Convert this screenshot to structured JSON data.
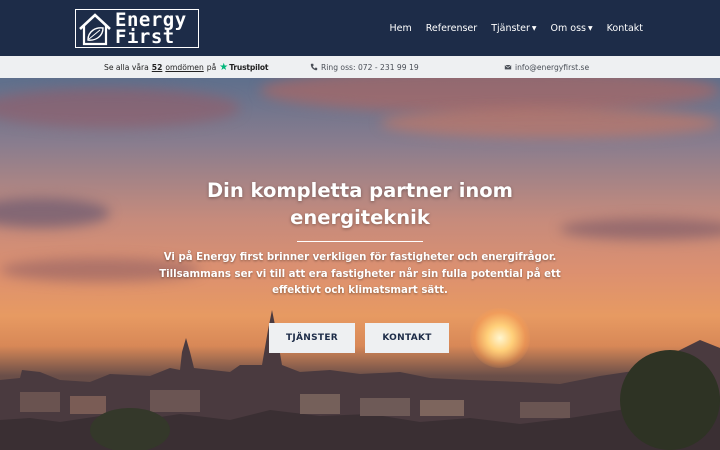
{
  "logo": {
    "line1": "Energy",
    "line2": "First",
    "icon": "house-leaf-icon"
  },
  "nav": {
    "items": [
      {
        "label": "Hem",
        "has_dropdown": false
      },
      {
        "label": "Referenser",
        "has_dropdown": false
      },
      {
        "label": "Tjänster",
        "has_dropdown": true
      },
      {
        "label": "Om oss",
        "has_dropdown": true
      },
      {
        "label": "Kontakt",
        "has_dropdown": false
      }
    ],
    "caret": "⌄"
  },
  "infobar": {
    "trust_prefix": "Se alla våra",
    "trust_count": "52",
    "trust_link": "omdömen",
    "trust_on": "på",
    "trust_brand": "Trustpilot",
    "phone": "Ring oss: 072 - 231 99 19",
    "email": "info@energyfirst.se"
  },
  "hero": {
    "title": "Din kompletta partner inom energiteknik",
    "subtitle": "Vi på Energy first brinner verkligen för fastigheter och energifrågor. Tillsammans ser vi till att era fastigheter når sin fulla potential på ett effektivt och klimatsmart sätt.",
    "button_services": "TJÄNSTER",
    "button_contact": "KONTAKT"
  },
  "colors": {
    "header_bg": "#1d2c48",
    "infobar_bg": "#eef0f2",
    "trustpilot_green": "#00b67a"
  }
}
